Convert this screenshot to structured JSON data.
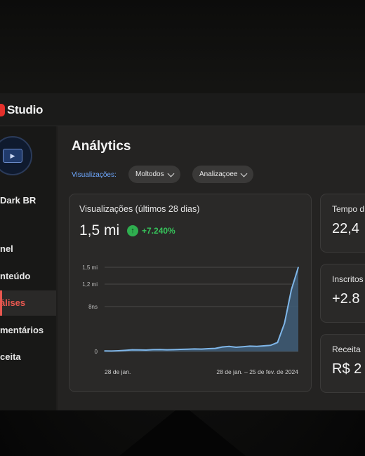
{
  "app": {
    "name": "Studio"
  },
  "channel": {
    "name": "Dark BR"
  },
  "sidebar": {
    "items": [
      {
        "label": "nel",
        "active": false
      },
      {
        "label": "nteúdo",
        "active": false
      },
      {
        "label": "álises",
        "active": true
      },
      {
        "label": "mentários",
        "active": false
      },
      {
        "label": "ceita",
        "active": false
      }
    ]
  },
  "page": {
    "title": "Análytics",
    "filter_label": "Visualizações:",
    "filters": [
      {
        "label": "Moltodos"
      },
      {
        "label": "Analizaçoee"
      }
    ]
  },
  "main_card": {
    "title": "Visualizações (últimos 28 dias)",
    "value": "1,5 mi",
    "delta": "+7.240%"
  },
  "side_cards": [
    {
      "title": "Tempo d",
      "value": "22,4"
    },
    {
      "title": "Inscritos",
      "value": "+2.8"
    },
    {
      "title": "Receita",
      "value": "R$ 2"
    }
  ],
  "chart_data": {
    "type": "area",
    "ytick_labels": [
      "1,5 mi",
      "1,2 mi",
      "8ns",
      "0"
    ],
    "yticks": [
      1500000,
      1200000,
      800000,
      0
    ],
    "ylim": [
      0,
      1500000
    ],
    "x_start_label": "28 de jan.",
    "x_range_label": "28 de jan. – 25 de fev. de 2024",
    "x": [
      1,
      2,
      3,
      4,
      5,
      6,
      7,
      8,
      9,
      10,
      11,
      12,
      13,
      14,
      15,
      16,
      17,
      18,
      19,
      20,
      21,
      22,
      23,
      24,
      25,
      26,
      27,
      28,
      29
    ],
    "values": [
      10000,
      8000,
      12000,
      20000,
      30000,
      28000,
      25000,
      32000,
      35000,
      30000,
      33000,
      38000,
      40000,
      45000,
      42000,
      50000,
      55000,
      80000,
      90000,
      75000,
      85000,
      95000,
      90000,
      100000,
      110000,
      160000,
      500000,
      1100000,
      1500000
    ],
    "colors": {
      "line": "#7fb6e8",
      "fill": "#3f5d78"
    }
  }
}
